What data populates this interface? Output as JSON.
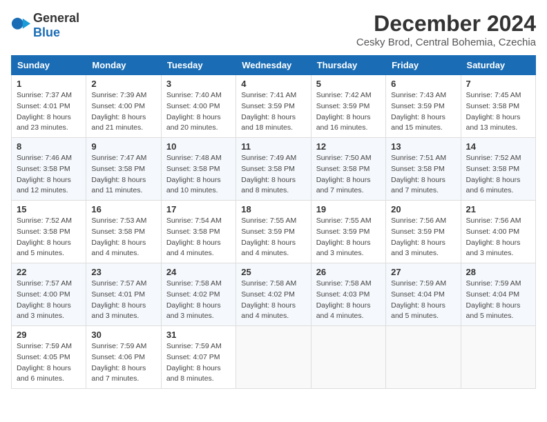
{
  "logo": {
    "general": "General",
    "blue": "Blue"
  },
  "title": {
    "month": "December 2024",
    "location": "Cesky Brod, Central Bohemia, Czechia"
  },
  "weekdays": [
    "Sunday",
    "Monday",
    "Tuesday",
    "Wednesday",
    "Thursday",
    "Friday",
    "Saturday"
  ],
  "weeks": [
    [
      {
        "day": 1,
        "sunrise": "7:37 AM",
        "sunset": "4:01 PM",
        "daylight": "8 hours and 23 minutes."
      },
      {
        "day": 2,
        "sunrise": "7:39 AM",
        "sunset": "4:00 PM",
        "daylight": "8 hours and 21 minutes."
      },
      {
        "day": 3,
        "sunrise": "7:40 AM",
        "sunset": "4:00 PM",
        "daylight": "8 hours and 20 minutes."
      },
      {
        "day": 4,
        "sunrise": "7:41 AM",
        "sunset": "3:59 PM",
        "daylight": "8 hours and 18 minutes."
      },
      {
        "day": 5,
        "sunrise": "7:42 AM",
        "sunset": "3:59 PM",
        "daylight": "8 hours and 16 minutes."
      },
      {
        "day": 6,
        "sunrise": "7:43 AM",
        "sunset": "3:59 PM",
        "daylight": "8 hours and 15 minutes."
      },
      {
        "day": 7,
        "sunrise": "7:45 AM",
        "sunset": "3:58 PM",
        "daylight": "8 hours and 13 minutes."
      }
    ],
    [
      {
        "day": 8,
        "sunrise": "7:46 AM",
        "sunset": "3:58 PM",
        "daylight": "8 hours and 12 minutes."
      },
      {
        "day": 9,
        "sunrise": "7:47 AM",
        "sunset": "3:58 PM",
        "daylight": "8 hours and 11 minutes."
      },
      {
        "day": 10,
        "sunrise": "7:48 AM",
        "sunset": "3:58 PM",
        "daylight": "8 hours and 10 minutes."
      },
      {
        "day": 11,
        "sunrise": "7:49 AM",
        "sunset": "3:58 PM",
        "daylight": "8 hours and 8 minutes."
      },
      {
        "day": 12,
        "sunrise": "7:50 AM",
        "sunset": "3:58 PM",
        "daylight": "8 hours and 7 minutes."
      },
      {
        "day": 13,
        "sunrise": "7:51 AM",
        "sunset": "3:58 PM",
        "daylight": "8 hours and 7 minutes."
      },
      {
        "day": 14,
        "sunrise": "7:52 AM",
        "sunset": "3:58 PM",
        "daylight": "8 hours and 6 minutes."
      }
    ],
    [
      {
        "day": 15,
        "sunrise": "7:52 AM",
        "sunset": "3:58 PM",
        "daylight": "8 hours and 5 minutes."
      },
      {
        "day": 16,
        "sunrise": "7:53 AM",
        "sunset": "3:58 PM",
        "daylight": "8 hours and 4 minutes."
      },
      {
        "day": 17,
        "sunrise": "7:54 AM",
        "sunset": "3:58 PM",
        "daylight": "8 hours and 4 minutes."
      },
      {
        "day": 18,
        "sunrise": "7:55 AM",
        "sunset": "3:59 PM",
        "daylight": "8 hours and 4 minutes."
      },
      {
        "day": 19,
        "sunrise": "7:55 AM",
        "sunset": "3:59 PM",
        "daylight": "8 hours and 3 minutes."
      },
      {
        "day": 20,
        "sunrise": "7:56 AM",
        "sunset": "3:59 PM",
        "daylight": "8 hours and 3 minutes."
      },
      {
        "day": 21,
        "sunrise": "7:56 AM",
        "sunset": "4:00 PM",
        "daylight": "8 hours and 3 minutes."
      }
    ],
    [
      {
        "day": 22,
        "sunrise": "7:57 AM",
        "sunset": "4:00 PM",
        "daylight": "8 hours and 3 minutes."
      },
      {
        "day": 23,
        "sunrise": "7:57 AM",
        "sunset": "4:01 PM",
        "daylight": "8 hours and 3 minutes."
      },
      {
        "day": 24,
        "sunrise": "7:58 AM",
        "sunset": "4:02 PM",
        "daylight": "8 hours and 3 minutes."
      },
      {
        "day": 25,
        "sunrise": "7:58 AM",
        "sunset": "4:02 PM",
        "daylight": "8 hours and 4 minutes."
      },
      {
        "day": 26,
        "sunrise": "7:58 AM",
        "sunset": "4:03 PM",
        "daylight": "8 hours and 4 minutes."
      },
      {
        "day": 27,
        "sunrise": "7:59 AM",
        "sunset": "4:04 PM",
        "daylight": "8 hours and 5 minutes."
      },
      {
        "day": 28,
        "sunrise": "7:59 AM",
        "sunset": "4:04 PM",
        "daylight": "8 hours and 5 minutes."
      }
    ],
    [
      {
        "day": 29,
        "sunrise": "7:59 AM",
        "sunset": "4:05 PM",
        "daylight": "8 hours and 6 minutes."
      },
      {
        "day": 30,
        "sunrise": "7:59 AM",
        "sunset": "4:06 PM",
        "daylight": "8 hours and 7 minutes."
      },
      {
        "day": 31,
        "sunrise": "7:59 AM",
        "sunset": "4:07 PM",
        "daylight": "8 hours and 8 minutes."
      },
      null,
      null,
      null,
      null
    ]
  ]
}
